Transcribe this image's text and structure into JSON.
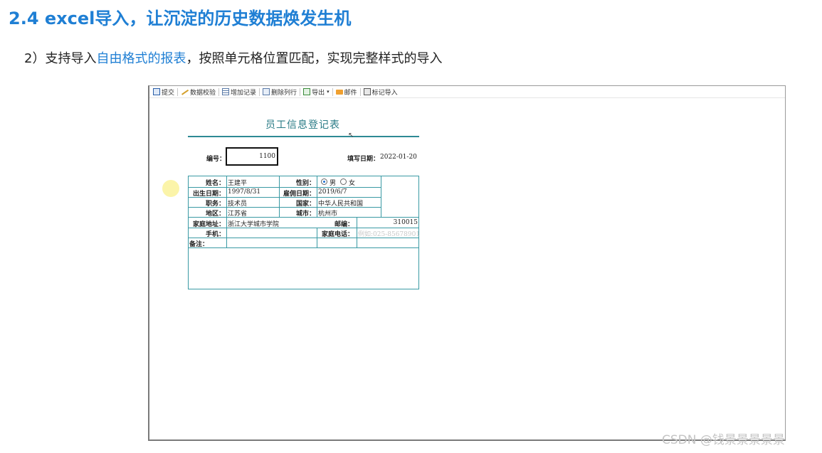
{
  "slide": {
    "title": "2.4 excel导入，让沉淀的历史数据焕发生机",
    "subtitle_prefix": "2）支持导入",
    "subtitle_highlight": "自由格式的报表",
    "subtitle_suffix": "，按照单元格位置匹配，实现完整样式的导入",
    "accent_color": "#1f7fd4"
  },
  "toolbar": {
    "submit": "提交",
    "validate": "数据校验",
    "add_record": "增加记录",
    "delete_row": "删除列行",
    "export": "导出",
    "export_caret": "▾",
    "mail": "邮件",
    "mark_import": "标记导入"
  },
  "form": {
    "title": "员工信息登记表",
    "id_label": "编号：",
    "id_value": "1100",
    "date_label": "填写日期：",
    "date_value": "2022-01-20",
    "name_label": "姓名：",
    "name_value": "王建平",
    "gender_label": "性别：",
    "gender_male": "男",
    "gender_female": "女",
    "birth_label": "出生日期：",
    "birth_value": "1997/8/31",
    "hire_label": "雇佣日期：",
    "hire_value": "2019/6/7",
    "job_label": "职务：",
    "job_value": "技术员",
    "country_label": "国家：",
    "country_value": "中华人民共和国",
    "region_label": "地区：",
    "region_value": "江苏省",
    "city_label": "城市：",
    "city_value": "杭州市",
    "address_label": "家庭地址：",
    "address_value": "浙江大学城市学院",
    "zip_label": "邮编：",
    "zip_value": "310015",
    "mobile_label": "手机：",
    "mobile_value": "",
    "phone_label": "家庭电话：",
    "phone_placeholder": "例如:025-85678901",
    "remark_label": "备注："
  },
  "watermark": "CSDN @钱景景景景景"
}
